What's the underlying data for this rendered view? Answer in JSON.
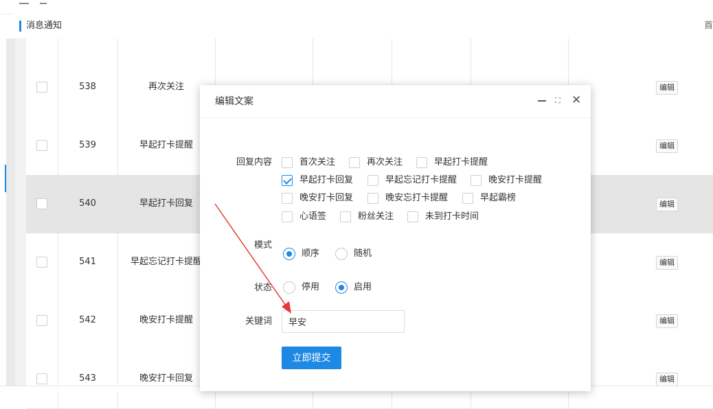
{
  "header": {
    "breadcrumb": "消息通知",
    "home_link": "首"
  },
  "table": {
    "rows": [
      {
        "id": "538",
        "name": "再次关注",
        "edit": "编辑"
      },
      {
        "id": "539",
        "name": "早起打卡提醒",
        "edit": "编辑"
      },
      {
        "id": "540",
        "name": "早起打卡回复",
        "edit": "编辑"
      },
      {
        "id": "541",
        "name": "早起忘记打卡提醒",
        "edit": "编辑"
      },
      {
        "id": "542",
        "name": "晚安打卡提醒",
        "edit": "编辑"
      },
      {
        "id": "543",
        "name": "晚安打卡回复",
        "edit": "编辑"
      }
    ]
  },
  "modal": {
    "title": "编辑文案",
    "controls": {
      "maximize": "⛶",
      "close": "✕"
    },
    "reply_label": "回复内容",
    "reply_options": [
      {
        "label": "首次关注",
        "checked": false
      },
      {
        "label": "再次关注",
        "checked": false
      },
      {
        "label": "早起打卡提醒",
        "checked": false
      },
      {
        "label": "早起打卡回复",
        "checked": true
      },
      {
        "label": "早起忘记打卡提醒",
        "checked": false
      },
      {
        "label": "晚安打卡提醒",
        "checked": false
      },
      {
        "label": "晚安打卡回复",
        "checked": false
      },
      {
        "label": "晚安忘打卡提醒",
        "checked": false
      },
      {
        "label": "早起霸榜",
        "checked": false
      },
      {
        "label": "心语签",
        "checked": false
      },
      {
        "label": "粉丝关注",
        "checked": false
      },
      {
        "label": "未到打卡时间",
        "checked": false
      }
    ],
    "mode_label": "模式",
    "mode_options": [
      {
        "label": "顺序",
        "selected": true
      },
      {
        "label": "随机",
        "selected": false
      }
    ],
    "status_label": "状态",
    "status_options": [
      {
        "label": "停用",
        "selected": false
      },
      {
        "label": "启用",
        "selected": true
      }
    ],
    "keyword_label": "关键词",
    "keyword_value": "早安",
    "submit_label": "立即提交"
  },
  "colors": {
    "accent": "#1e88e5",
    "annotation_arrow": "#e53935"
  }
}
